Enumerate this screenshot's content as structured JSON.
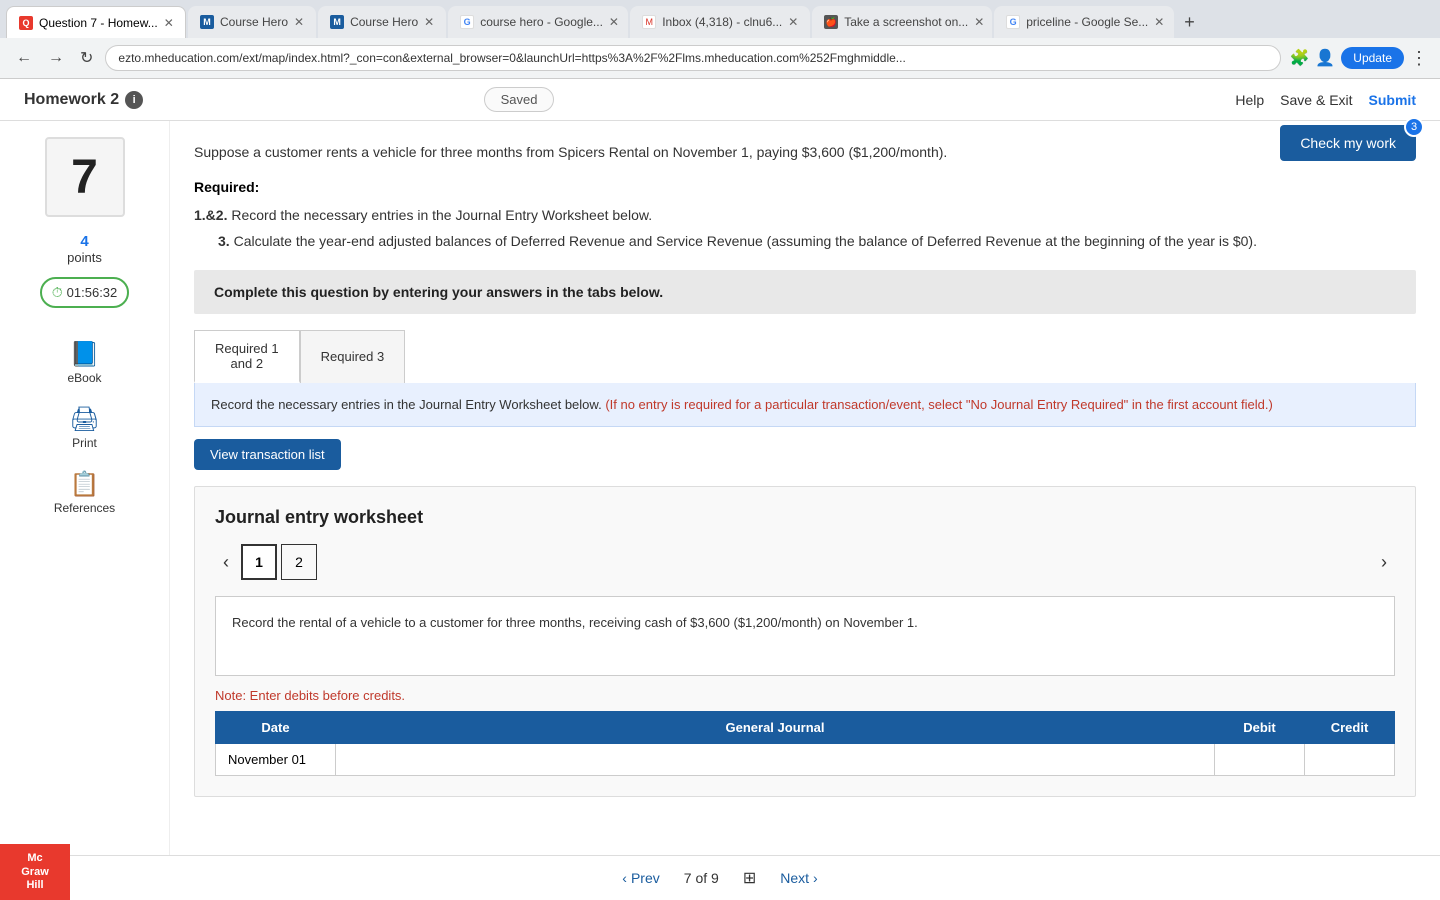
{
  "browser": {
    "address": "ezto.mheducation.com/ext/map/index.html?_con=con&external_browser=0&launchUrl=https%3A%2F%2Flms.mheducation.com%252Fmghmiddle...",
    "update_label": "Update",
    "tabs": [
      {
        "id": "q7",
        "label": "Question 7 - Homew...",
        "favicon_type": "q7",
        "active": true
      },
      {
        "id": "ch1",
        "label": "Course Hero",
        "favicon_type": "ch",
        "active": false
      },
      {
        "id": "ch2",
        "label": "Course Hero",
        "favicon_type": "ch",
        "active": false
      },
      {
        "id": "cg",
        "label": "course hero - Google...",
        "favicon_type": "g",
        "active": false
      },
      {
        "id": "inbox",
        "label": "Inbox (4,318) - clnu6...",
        "favicon_type": "m",
        "active": false
      },
      {
        "id": "screenshot",
        "label": "Take a screenshot on...",
        "favicon_type": "apple",
        "active": false
      },
      {
        "id": "priceline",
        "label": "priceline - Google Se...",
        "favicon_type": "g",
        "active": false
      }
    ]
  },
  "header": {
    "title": "Homework 2",
    "saved_label": "Saved",
    "help_label": "Help",
    "save_exit_label": "Save & Exit",
    "submit_label": "Submit"
  },
  "check_work": {
    "label": "Check my work",
    "badge": "3"
  },
  "sidebar": {
    "question_number": "7",
    "points_label": "points",
    "points_value": "4",
    "timer": "01:56:32",
    "tools": [
      {
        "id": "ebook",
        "label": "eBook",
        "icon": "📖"
      },
      {
        "id": "print",
        "label": "Print",
        "icon": "🖨"
      },
      {
        "id": "references",
        "label": "References",
        "icon": "📋"
      }
    ]
  },
  "question": {
    "text": "Suppose a customer rents a vehicle for three months from Spicers Rental on November 1, paying $3,600 ($1,200/month).",
    "required_label": "Required:",
    "items": [
      {
        "num": "1.&2.",
        "text": "Record the necessary entries in the Journal Entry Worksheet below."
      },
      {
        "num": "3.",
        "text": "Calculate the year-end adjusted balances of Deferred Revenue and Service Revenue (assuming the balance of Deferred Revenue at the beginning of the year is $0)."
      }
    ]
  },
  "instructions_box": {
    "text": "Complete this question by entering your answers in the tabs below."
  },
  "tabs": [
    {
      "id": "req12",
      "label": "Required 1\nand 2",
      "active": true
    },
    {
      "id": "req3",
      "label": "Required 3",
      "active": false
    }
  ],
  "info_banner": {
    "text": "Record the necessary entries in the Journal Entry Worksheet below.",
    "red_text": "(If no entry is required for a particular transaction/event, select \"No Journal Entry Required\" in the first account field.)"
  },
  "view_transaction_btn": "View transaction list",
  "journal": {
    "title": "Journal entry worksheet",
    "pages": [
      "1",
      "2"
    ],
    "active_page": "1",
    "description": "Record the rental of a vehicle to a customer for three months, receiving cash of $3,600 ($1,200/month) on November 1.",
    "note": "Note: Enter debits before credits.",
    "table": {
      "headers": [
        "Date",
        "General Journal",
        "Debit",
        "Credit"
      ],
      "rows": [
        {
          "date": "November 01",
          "general_journal": "",
          "debit": "",
          "credit": ""
        }
      ]
    }
  },
  "bottom_nav": {
    "prev_label": "Prev",
    "page_current": "7",
    "page_total": "9",
    "next_label": "Next"
  },
  "logo": {
    "line1": "Mc",
    "line2": "Graw",
    "line3": "Hill"
  }
}
